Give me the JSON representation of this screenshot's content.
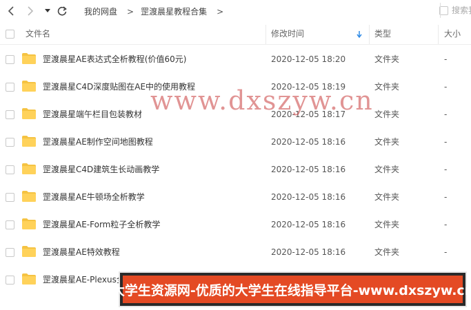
{
  "toolbar": {
    "breadcrumb": [
      "我的网盘",
      "罡渡晨星教程合集"
    ],
    "search_placeholder": "搜索我"
  },
  "columns": {
    "name": "文件名",
    "modified": "修改时间",
    "type": "类型",
    "size": "大小"
  },
  "files": [
    {
      "name": "罡渡晨星AE表达式全析教程(价值60元)",
      "modified": "2020-12-05 18:20",
      "type": "文件夹",
      "size": "-"
    },
    {
      "name": "罡渡晨星C4D深度贴图在AE中的使用教程",
      "modified": "2020-12-05 18:19",
      "type": "文件夹",
      "size": "-"
    },
    {
      "name": "罡渡晨星端午栏目包装教材",
      "modified": "2020-12-05 18:17",
      "type": "文件夹",
      "size": "-"
    },
    {
      "name": "罡渡晨星AE制作空间地图教程",
      "modified": "2020-12-05 18:16",
      "type": "文件夹",
      "size": "-"
    },
    {
      "name": "罡渡晨星C4D建筑生长动画教学",
      "modified": "2020-12-05 18:16",
      "type": "文件夹",
      "size": "-"
    },
    {
      "name": "罡渡晨星AE牛顿场全析教学",
      "modified": "2020-12-05 18:16",
      "type": "文件夹",
      "size": "-"
    },
    {
      "name": "罡渡晨星AE-Form粒子全析教学",
      "modified": "2020-12-05 18:16",
      "type": "文件夹",
      "size": "-"
    },
    {
      "name": "罡渡晨星AE特效教程",
      "modified": "2020-12-05 18:16",
      "type": "文件夹",
      "size": "-"
    },
    {
      "name": "罡渡晨星AE-Plexus全",
      "modified": "",
      "type": "",
      "size": ""
    }
  ],
  "watermark": "www.dxszyw.cn",
  "banner": "大学生资源网-优质的大学生在线指导平台-www.dxszyw.cn",
  "colors": {
    "folder": "#f5c342",
    "banner_bg": "#e44a24",
    "sort_arrow": "#2e8ae6"
  }
}
